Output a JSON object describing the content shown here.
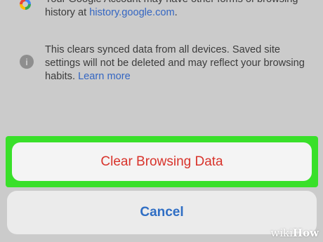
{
  "sync_notes": {
    "account_note": {
      "text": "Your Google Account may have other forms of browsing history at ",
      "link": "history.google.com",
      "tail": "."
    },
    "synced_data_note": {
      "text": "This clears synced data from all devices. Saved site settings will not be deleted and may reflect your browsing habits. ",
      "link": "Learn more"
    }
  },
  "action_sheet": {
    "clear_label": "Clear Browsing Data",
    "cancel_label": "Cancel"
  },
  "watermark": {
    "wiki": "wiki",
    "how": "How"
  },
  "colors": {
    "highlight": "#39e02a",
    "destructive": "#d8332b",
    "link": "#3466c2",
    "cancel": "#2f6ec4"
  },
  "icons": {
    "account_note_icon": "google-g-icon",
    "synced_data_note_icon": "info-icon"
  }
}
